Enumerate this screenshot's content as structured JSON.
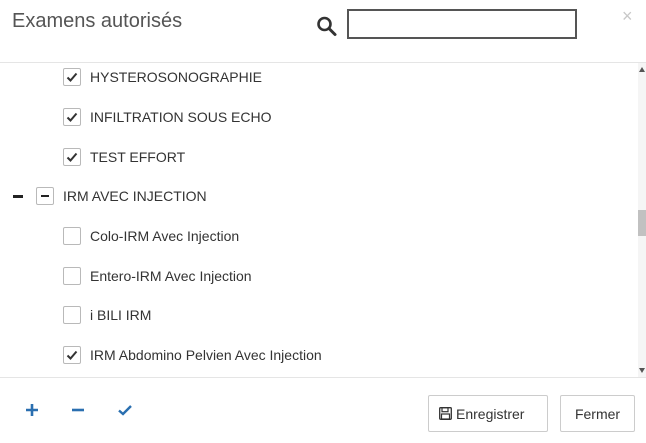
{
  "header": {
    "title": "Examens autorisés",
    "search_value": ""
  },
  "tree": {
    "items": [
      {
        "label": "HYSTEROSONOGRAPHIE",
        "checked": true
      },
      {
        "label": "INFILTRATION SOUS ECHO",
        "checked": true
      },
      {
        "label": "TEST EFFORT",
        "checked": true
      },
      {
        "label": "IRM AVEC INJECTION",
        "state": "partial",
        "expanded": true
      },
      {
        "label": "Colo-IRM Avec Injection",
        "checked": false
      },
      {
        "label": "Entero-IRM Avec Injection",
        "checked": false
      },
      {
        "label": "i BILI IRM",
        "checked": false
      },
      {
        "label": "IRM Abdomino Pelvien Avec Injection",
        "checked": true
      }
    ]
  },
  "footer": {
    "expand_all_icon": "plus-icon",
    "collapse_all_icon": "minus-icon",
    "check_all_icon": "check-icon",
    "save_label": "Enregistrer",
    "close_label": "Fermer"
  },
  "colors": {
    "accent": "#2a6fb0",
    "text": "#333333",
    "border": "#cccccc"
  }
}
